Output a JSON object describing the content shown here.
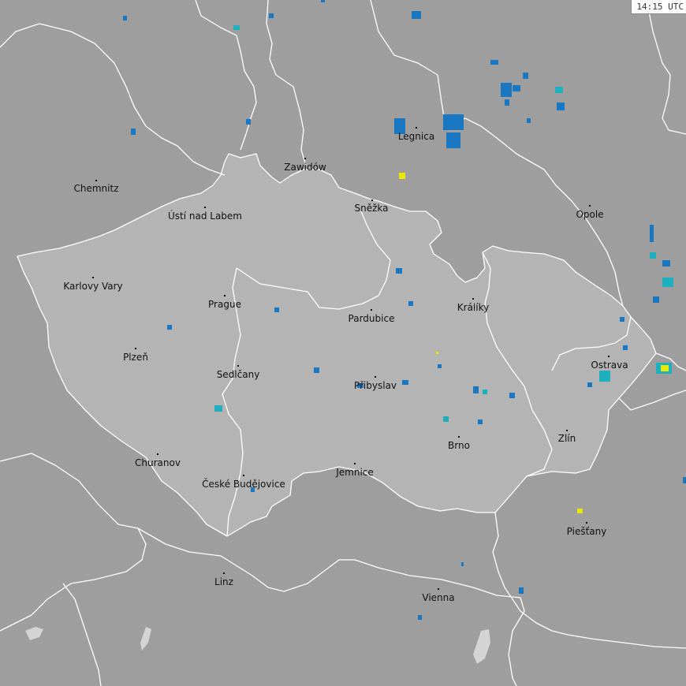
{
  "timestamp": "14:15 UTC",
  "colors": {
    "background": "#9e9e9e",
    "czech_region": "#b4b4b4",
    "border_line": "#ffffff",
    "lake": "#d4d4d4",
    "strike_blue": "#1a78c2",
    "strike_cyan": "#1fb0c0",
    "strike_yellow": "#e8e800",
    "label_text": "#111111"
  },
  "cities": [
    {
      "name": "Chemnitz"
    },
    {
      "name": "Zawidów"
    },
    {
      "name": "Legnica"
    },
    {
      "name": "Ústí nad Labem"
    },
    {
      "name": "Sněžka"
    },
    {
      "name": "Opole"
    },
    {
      "name": "Karlovy Vary"
    },
    {
      "name": "Prague"
    },
    {
      "name": "Pardubice"
    },
    {
      "name": "Králíky"
    },
    {
      "name": "Plzeň"
    },
    {
      "name": "Ostrava"
    },
    {
      "name": "Sedlčany"
    },
    {
      "name": "Přibyslav"
    },
    {
      "name": "Zlín"
    },
    {
      "name": "Brno"
    },
    {
      "name": "Churanov"
    },
    {
      "name": "České Budějovice"
    },
    {
      "name": "Jemnice"
    },
    {
      "name": "Piešťany"
    },
    {
      "name": "Linz"
    },
    {
      "name": "Vienna"
    }
  ]
}
